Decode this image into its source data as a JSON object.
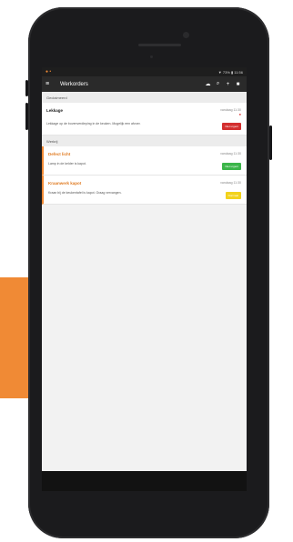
{
  "status": {
    "left": "● •",
    "right": "▼ 73% ▮ 11:56"
  },
  "appbar": {
    "menu_icon": "≡",
    "title": "Werkorders",
    "upload_icon": "☁",
    "search_icon": "⌕",
    "add_icon": "+",
    "more_icon": "■"
  },
  "sections": [
    {
      "label": "Geclaimeerd",
      "cards": [
        {
          "title": "Lekkage",
          "meta": "vandaag 11:30",
          "pin": "●",
          "desc": "Lekkage op de bovenverdieping in de keuken. Mogelijk een afvoer.",
          "badge": "Niet urgent",
          "badge_color": "#d32f2f"
        }
      ]
    },
    {
      "label": "Werkrij",
      "cards": [
        {
          "title": "Defect licht",
          "meta": "vandaag 11:30",
          "desc": "Lamp in de kelder is kapot.",
          "badge": "Niet urgent",
          "badge_color": "#3cb54a"
        },
        {
          "title": "Kraanwerk kapot",
          "meta": "vandaag 11:30",
          "desc": "Kraan bij de keukentafel is kapot. Graag vervangen.",
          "badge": "Normaal",
          "badge_color": "#f2d21b"
        }
      ]
    }
  ],
  "accent": "#f08a35"
}
